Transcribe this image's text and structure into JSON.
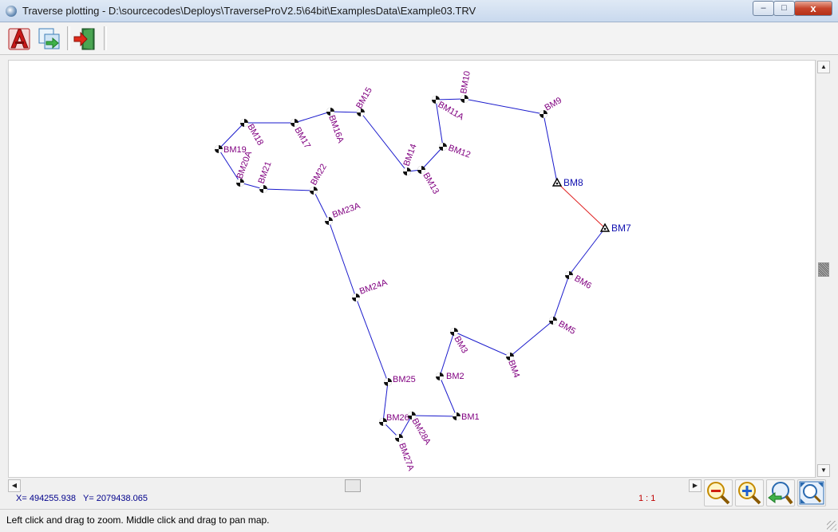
{
  "window": {
    "title": "Traverse plotting - D:\\sourcecodes\\Deploys\\TraverseProV2.5\\64bit\\ExamplesData\\Example03.TRV"
  },
  "window_controls": {
    "minimize": "–",
    "maximize": "□",
    "close": "x"
  },
  "colors": {
    "traverse_line": "#1a1acc",
    "closing_line": "#e02020",
    "station_label": "#800080",
    "control_label": "#1010b0",
    "coordinates": "#00008b",
    "scale": "#c00000"
  },
  "toolbar": {
    "buttons": [
      {
        "icon": "autocad-export-icon"
      },
      {
        "icon": "copy-to-clipboard-icon"
      },
      {
        "icon": "exit-icon"
      }
    ]
  },
  "map": {
    "stations": [
      {
        "name": "BM1"
      },
      {
        "name": "BM2"
      },
      {
        "name": "BM3"
      },
      {
        "name": "BM4"
      },
      {
        "name": "BM5"
      },
      {
        "name": "BM6"
      },
      {
        "name": "BM7",
        "control": true
      },
      {
        "name": "BM8",
        "control": true
      },
      {
        "name": "BM9"
      },
      {
        "name": "BM10"
      },
      {
        "name": "BM11A"
      },
      {
        "name": "BM12"
      },
      {
        "name": "BM13"
      },
      {
        "name": "BM14"
      },
      {
        "name": "BM15"
      },
      {
        "name": "BM16A"
      },
      {
        "name": "BM17"
      },
      {
        "name": "BM18"
      },
      {
        "name": "BM19"
      },
      {
        "name": "BM20A"
      },
      {
        "name": "BM21"
      },
      {
        "name": "BM22"
      },
      {
        "name": "BM23A"
      },
      {
        "name": "BM24A"
      },
      {
        "name": "BM25"
      },
      {
        "name": "BM26"
      },
      {
        "name": "BM27A"
      },
      {
        "name": "BM28A"
      }
    ]
  },
  "scrollbars": {
    "up": "▲",
    "down": "▼",
    "left": "◀",
    "right": "▶"
  },
  "coords": {
    "x_label": "X=",
    "x_value": "494255.938",
    "y_label": "Y=",
    "y_value": "2079438.065"
  },
  "scale_ratio": "1 : 1",
  "zoom_buttons": [
    {
      "icon": "zoom-out-icon"
    },
    {
      "icon": "zoom-in-icon"
    },
    {
      "icon": "zoom-previous-icon"
    },
    {
      "icon": "zoom-extents-icon"
    }
  ],
  "status": {
    "text": "Left click and drag to zoom. Middle click and drag to pan map."
  }
}
